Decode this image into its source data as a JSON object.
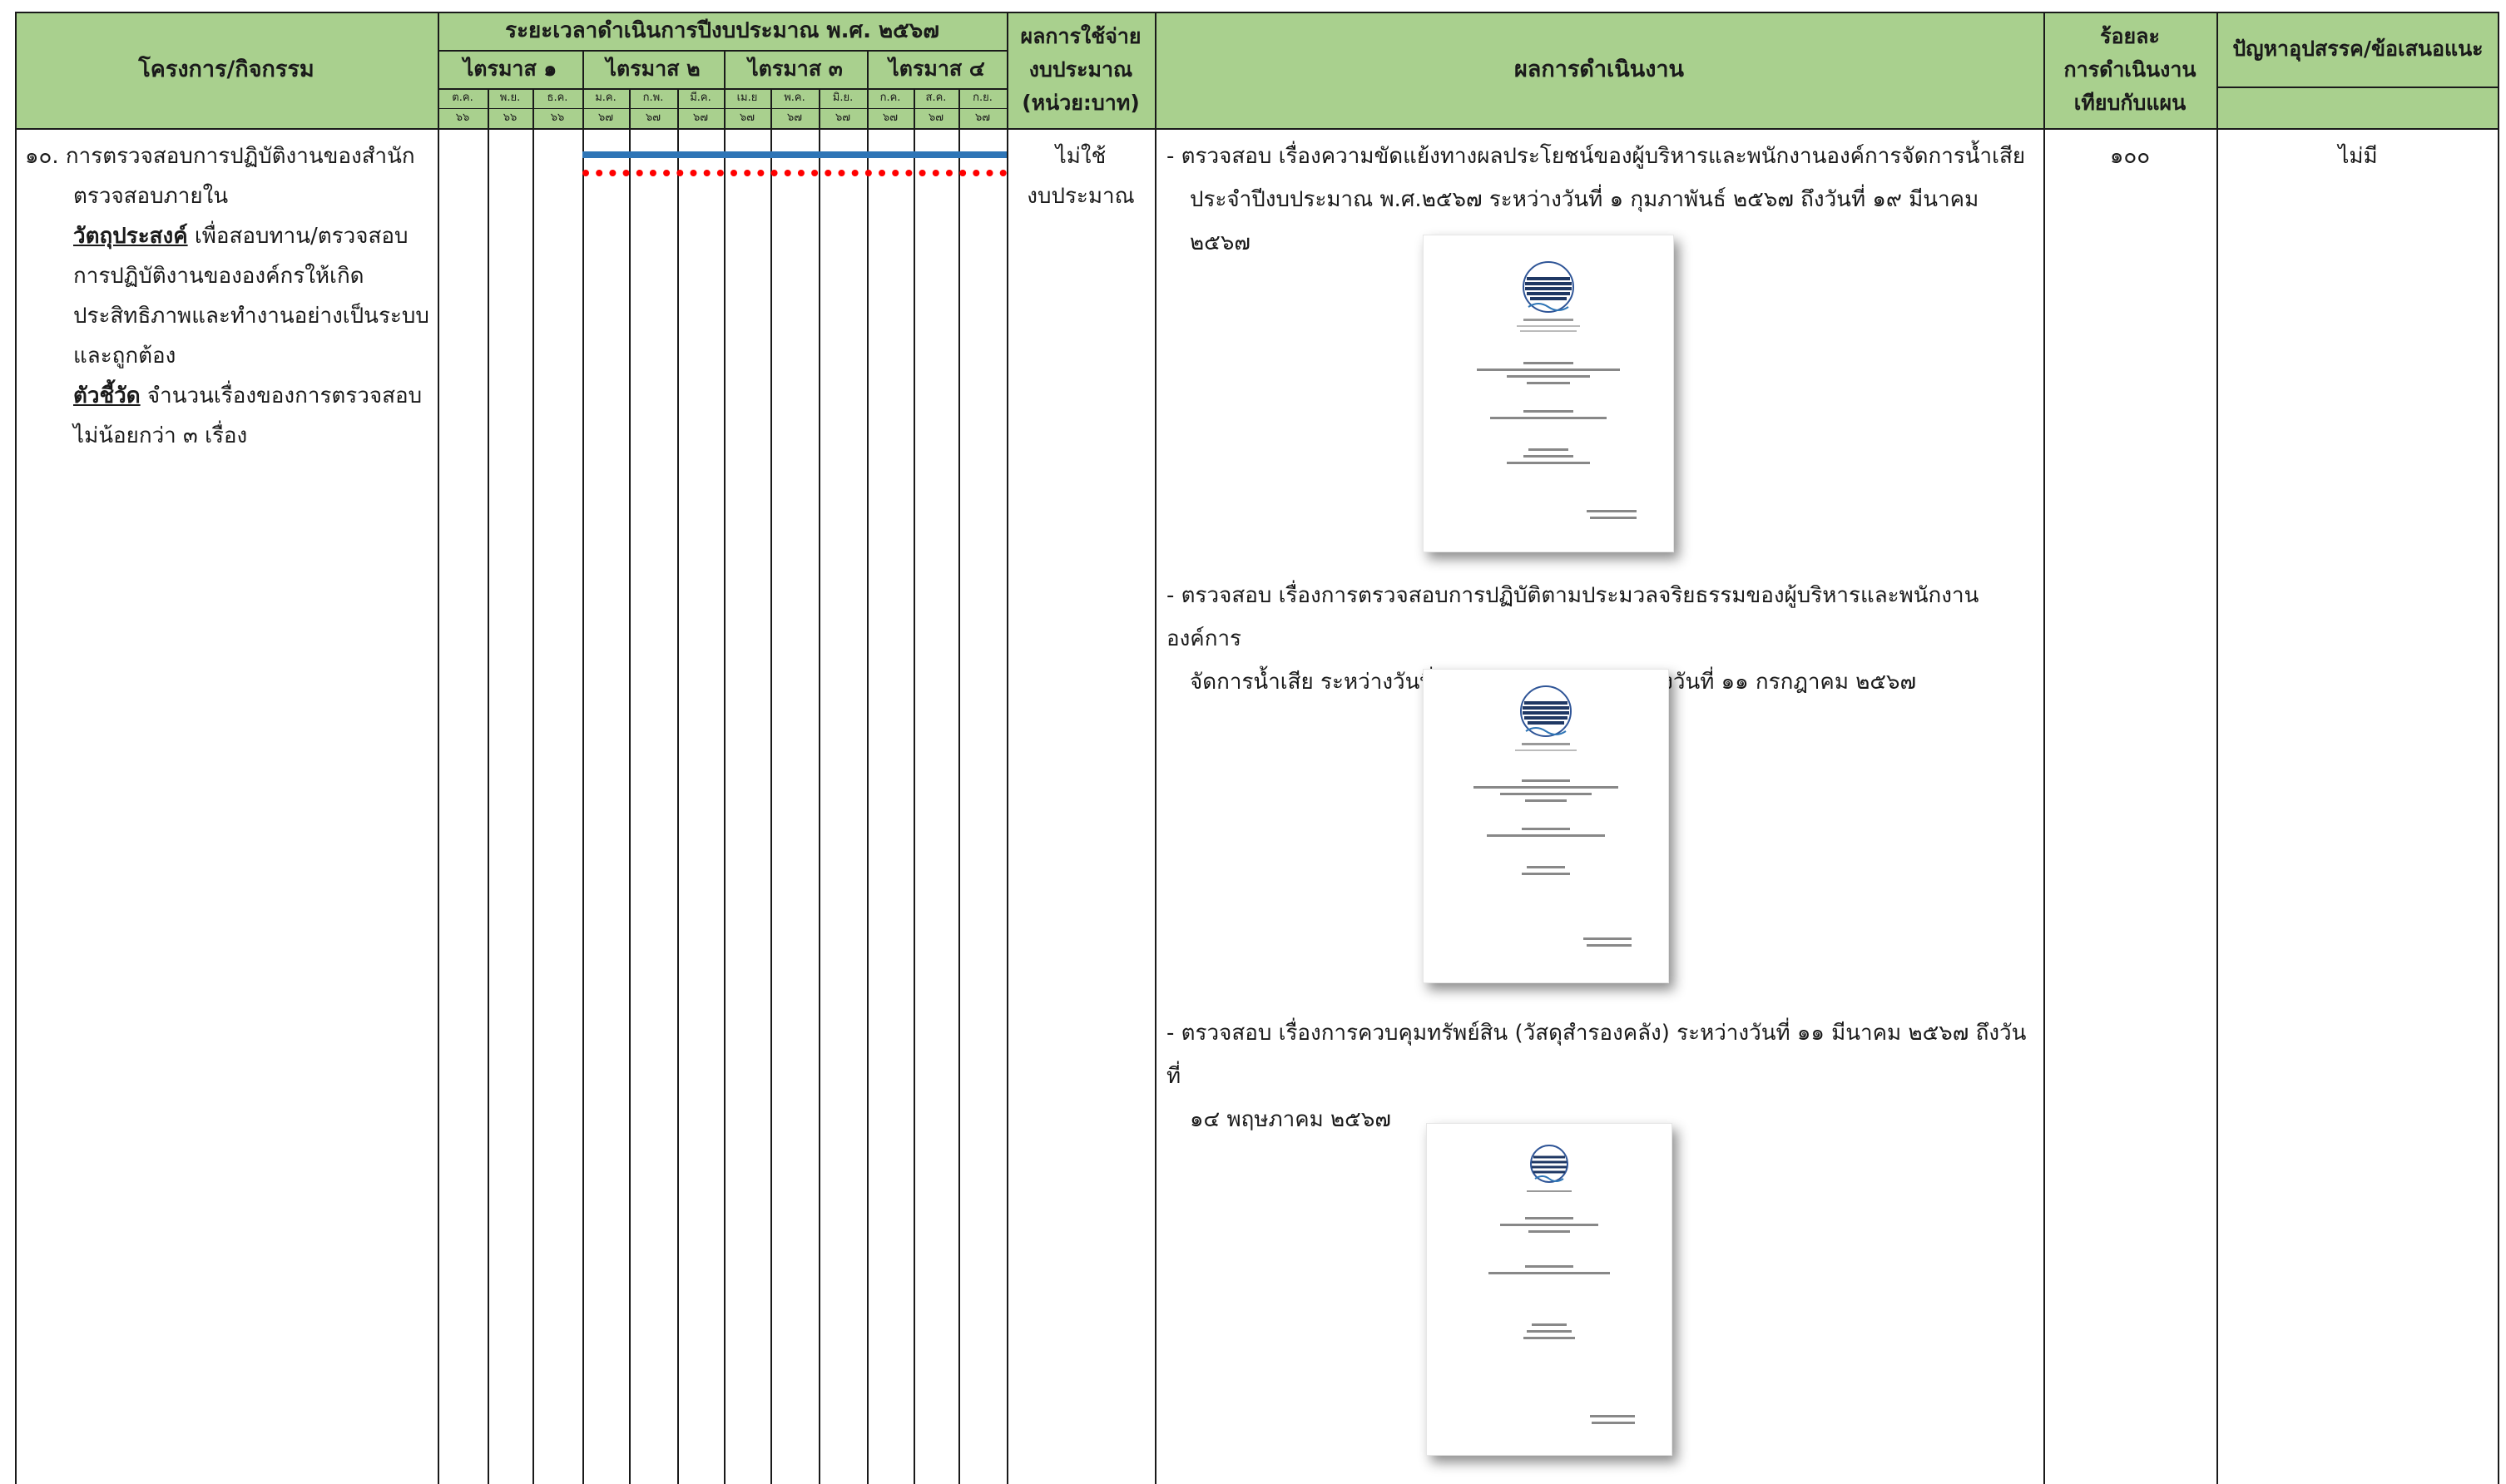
{
  "header": {
    "project_col": "โครงการ/กิจกรรม",
    "timeline_title": "ระยะเวลาดำเนินการปีงบประมาณ พ.ศ. ๒๕๖๗",
    "quarters": [
      "ไตรมาส ๑",
      "ไตรมาส ๒",
      "ไตรมาส ๓",
      "ไตรมาส ๔"
    ],
    "months": [
      "ต.ค.",
      "พ.ย.",
      "ธ.ค.",
      "ม.ค.",
      "ก.พ.",
      "มี.ค.",
      "เม.ย",
      "พ.ค.",
      "มิ.ย.",
      "ก.ค.",
      "ส.ค.",
      "ก.ย."
    ],
    "years": [
      "๖๖",
      "๖๖",
      "๖๖",
      "๖๗",
      "๖๗",
      "๖๗",
      "๖๗",
      "๖๗",
      "๖๗",
      "๖๗",
      "๖๗",
      "๖๗"
    ],
    "budget_line1": "ผลการใช้จ่าย",
    "budget_line2": "งบประมาณ",
    "budget_line3": "(หน่วย:บาท)",
    "results_col": "ผลการดำเนินงาน",
    "percent_line1": "ร้อยละ",
    "percent_line2": "การดำเนินงาน",
    "percent_line3": "เทียบกับแผน",
    "problems_col": "ปัญหาอุปสรรค/ข้อเสนอแนะ"
  },
  "row": {
    "activity_line1": "๑๐. การตรวจสอบการปฏิบัติงานของสำนัก",
    "activity_line2": "ตรวจสอบภายใน",
    "objective_label": "วัตถุประสงค์",
    "objective_line1": " เพื่อสอบทาน/ตรวจสอบ",
    "objective_line2": "การปฏิบัติงานขององค์กรให้เกิด",
    "objective_line3": "ประสิทธิภาพและทำงานอย่างเป็นระบบ",
    "objective_line4": "และถูกต้อง",
    "indicator_label": "ตัวชี้วัด",
    "indicator_line1": " จำนวนเรื่องของการตรวจสอบ",
    "indicator_line2": "ไม่น้อยกว่า ๓ เรื่อง",
    "timeline": {
      "plan_start_month": "ม.ค.",
      "plan_end_month": "ก.ย.",
      "actual_start_month": "ม.ค.",
      "actual_end_month": "ก.ย.",
      "plan_color": "#2e75b6",
      "actual_color": "#ff0000"
    },
    "budget_line1": "ไม่ใช้",
    "budget_line2": "งบประมาณ",
    "results": [
      {
        "line1": "-  ตรวจสอบ เรื่องความขัดแย้งทางผลประโยชน์ของผู้บริหารและพนักงานองค์การจัดการน้ำเสีย",
        "line2": "ประจำปีงบประมาณ พ.ศ.๒๕๖๗ ระหว่างวันที่ ๑ กุมภาพันธ์ ๒๕๖๗ ถึงวันที่ ๑๙ มีนาคม ๒๕๖๗"
      },
      {
        "line1": "-  ตรวจสอบ เรื่องการตรวจสอบการปฏิบัติตามประมวลจริยธรรมของผู้บริหารและพนักงานองค์การ",
        "line2": "จัดการน้ำเสีย ระหว่างวันที่ ๒๗ พฤษภาคม ๒๕๖๗ ถึงวันที่ ๑๑ กรกฎาคม ๒๕๖๗"
      },
      {
        "line1": "-  ตรวจสอบ เรื่องการควบคุมทรัพย์สิน (วัสดุสำรองคลัง) ระหว่างวันที่ ๑๑ มีนาคม ๒๕๖๗ ถึงวันที่",
        "line2": "๑๔ พฤษภาคม ๒๕๖๗"
      }
    ],
    "percent": "๑๐๐",
    "problems": "ไม่มี"
  }
}
